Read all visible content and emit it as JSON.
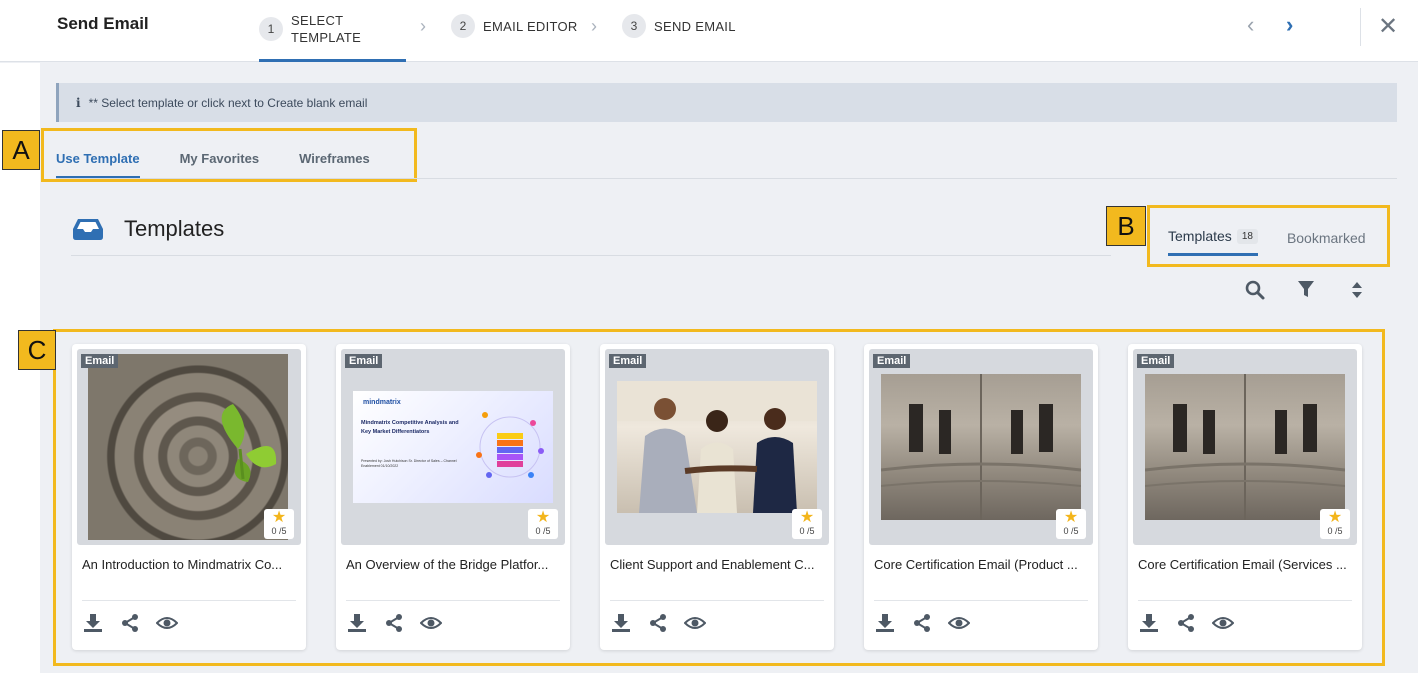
{
  "header": {
    "title": "Send Email",
    "steps": [
      {
        "num": "1",
        "label_line1": "SELECT",
        "label_line2": "TEMPLATE"
      },
      {
        "num": "2",
        "label": "EMAIL EDITOR"
      },
      {
        "num": "3",
        "label": "SEND EMAIL"
      }
    ]
  },
  "banner": {
    "text": "** Select template or click next to Create blank email"
  },
  "callouts": {
    "a": "A",
    "b": "B",
    "c": "C"
  },
  "main_tabs": [
    "Use Template",
    "My Favorites",
    "Wireframes"
  ],
  "section": {
    "title": "Templates"
  },
  "sub_tabs": {
    "templates_label": "Templates",
    "templates_count": "18",
    "bookmarked_label": "Bookmarked"
  },
  "cards": [
    {
      "type": "Email",
      "rating": "0 /5",
      "title": "An Introduction to Mindmatrix Co..."
    },
    {
      "type": "Email",
      "rating": "0 /5",
      "title": "An Overview of the Bridge Platfor..."
    },
    {
      "type": "Email",
      "rating": "0 /5",
      "title": "Client Support and Enablement C..."
    },
    {
      "type": "Email",
      "rating": "0 /5",
      "title": "Core Certification Email (Product ..."
    },
    {
      "type": "Email",
      "rating": "0 /5",
      "title": "Core Certification Email (Services ..."
    }
  ],
  "ppt_thumb": {
    "brand": "mindmatrix",
    "heading": "Mindmatrix Competitive Analysis and Key Market Differentiators",
    "presenter": "Presented by: Josh Hutchison Sr. Director of Sales – Channel Enablement 01/10/2022"
  },
  "colors": {
    "accent": "#2f6fb3",
    "callout": "#f2b91e",
    "star": "#f3b51b"
  }
}
